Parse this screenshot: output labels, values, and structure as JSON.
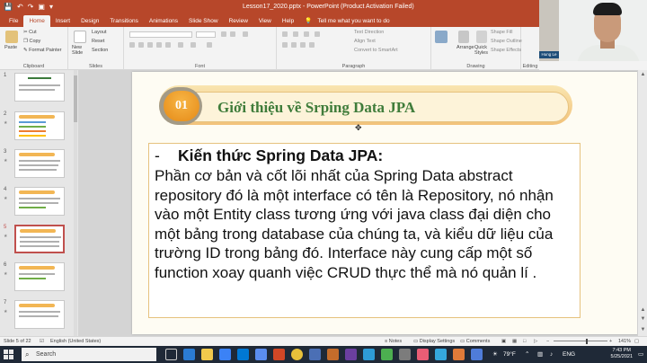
{
  "window": {
    "title": "Lesson17_2020.pptx  -  PowerPoint (Product Activation Failed)",
    "controls": [
      "—",
      "☐",
      "✕"
    ]
  },
  "tabs": [
    "File",
    "Home",
    "Insert",
    "Design",
    "Transitions",
    "Animations",
    "Slide Show",
    "Review",
    "View",
    "Help"
  ],
  "tell_me": "Tell me what you want to do",
  "ribbon": {
    "clipboard": {
      "label": "Clipboard",
      "paste": "Paste",
      "cut": "Cut",
      "copy": "Copy",
      "format_painter": "Format Painter"
    },
    "slides": {
      "label": "Slides",
      "new_slide": "New Slide",
      "layout": "Layout",
      "reset": "Reset",
      "section": "Section"
    },
    "font": {
      "label": "Font"
    },
    "paragraph": {
      "label": "Paragraph",
      "text_direction": "Text Direction",
      "align_text": "Align Text",
      "convert_smartart": "Convert to SmartArt"
    },
    "drawing": {
      "label": "Drawing",
      "arrange": "Arrange",
      "quick_styles": "Quick Styles",
      "shape_fill": "Shape Fill",
      "shape_outline": "Shape Outline",
      "shape_effects": "Shape Effects"
    },
    "editing": {
      "label": "Editing"
    }
  },
  "webcam": {
    "name": "Hung Le"
  },
  "slide_numbers": [
    "1",
    "2",
    "3",
    "4",
    "5",
    "6",
    "7"
  ],
  "slide": {
    "badge": "01",
    "title": "Giới thiệu về Srping Data JPA",
    "heading_dash": "-",
    "heading": "Kiến thức Spring Data JPA:",
    "paragraph": "Phần cơ bản và cốt lõi nhất của Spring Data abstract repository đó là một interface có tên là Repository, nó nhận vào một Entity class tương ứng với java class đại diện cho một bảng trong database của chúng ta, và kiểu dữ liệu của trường ID trong bảng đó. Interface này cung cấp một số function xoay quanh việc CRUD thực thể mà nó quản lí ."
  },
  "status": {
    "slide_of": "Slide 5 of 22",
    "language": "English (United States)",
    "notes": "Notes",
    "display_settings": "Display Settings",
    "comments": "Comments",
    "zoom": "141%"
  },
  "taskbar": {
    "search_placeholder": "Search",
    "weather": "79°F",
    "input_lang": "ENG",
    "time": "7:43 PM",
    "date": "5/25/2021"
  }
}
